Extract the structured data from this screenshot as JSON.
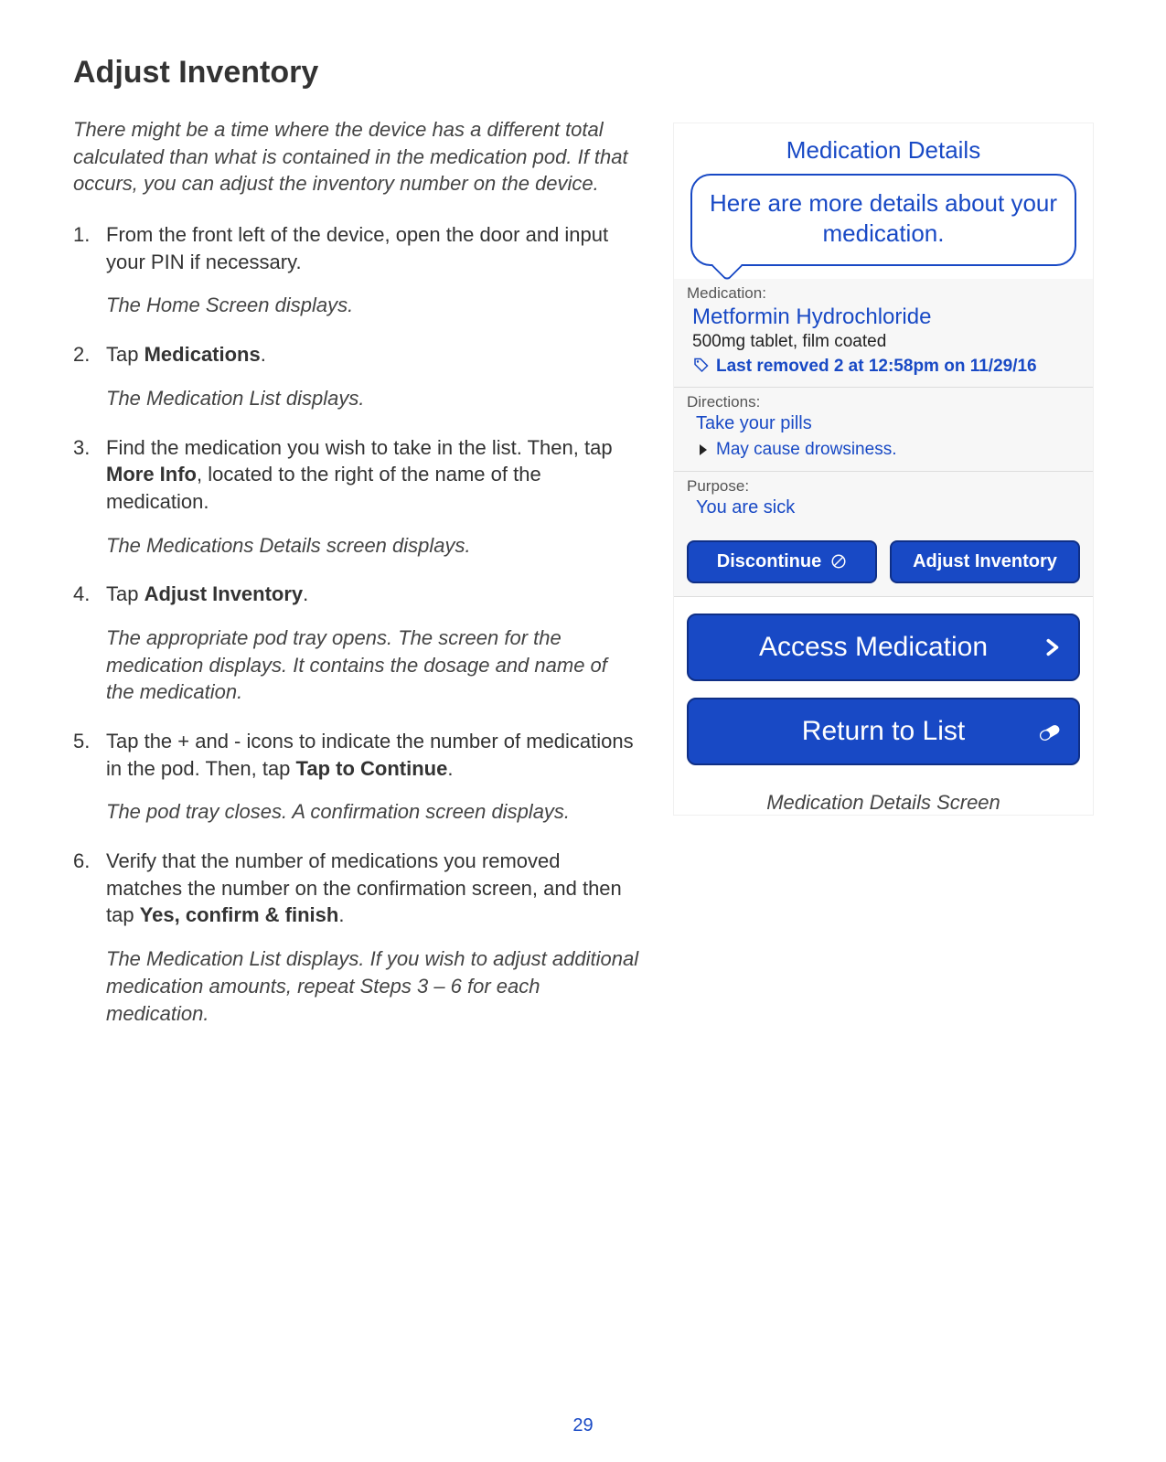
{
  "title": "Adjust Inventory",
  "intro": "There might be a time where the device has a different total calculated than what is contained in the medication pod.  If that occurs, you can adjust the inventory number on the device.",
  "steps": {
    "s1": {
      "text": "From the front left of the device, open the door and input your PIN if necessary.",
      "sub": "The Home Screen displays."
    },
    "s2": {
      "pre": "Tap ",
      "bold": "Medications",
      "post": ".",
      "sub": "The Medication List displays."
    },
    "s3": {
      "pre": "Find the medication you wish to take in the list.  Then, tap ",
      "bold": "More Info",
      "post": ", located to the right of the name of the medication.",
      "sub": "The Medications Details screen displays."
    },
    "s4": {
      "pre": "Tap ",
      "bold": "Adjust Inventory",
      "post": ".",
      "sub": "The appropriate pod tray opens. The screen for the medication displays.  It contains the dosage and name of the medication."
    },
    "s5": {
      "text_pre": "Tap the + and - icons to indicate the number of medications in the pod. Then, tap ",
      "bold": "Tap to Continue",
      "post": ".",
      "sub": "The pod tray closes. A confirmation screen displays."
    },
    "s6": {
      "pre": "Verify that the number of medications you removed matches the number on the confirmation screen, and then tap ",
      "bold": "Yes, confirm & finish",
      "post": ".",
      "sub": "The Medication List displays. If you wish to adjust additional medication amounts, repeat Steps 3 – 6 for each medication."
    }
  },
  "device": {
    "header": "Medication Details",
    "bubble": "Here are more details about your medication.",
    "med_label": "Medication:",
    "med_name": "Metformin Hydrochloride",
    "med_sub": "500mg tablet, film coated",
    "last_removed": "Last removed 2 at 12:58pm on 11/29/16",
    "dir_label": "Directions:",
    "dir_text": "Take your pills",
    "warn_text": "May cause drowsiness.",
    "purpose_label": "Purpose:",
    "purpose_text": "You are sick",
    "btn_discontinue": "Discontinue",
    "btn_adjust": "Adjust Inventory",
    "btn_access": "Access Medication",
    "btn_return": "Return to List",
    "caption": "Medication Details Screen"
  },
  "page_number": "29"
}
